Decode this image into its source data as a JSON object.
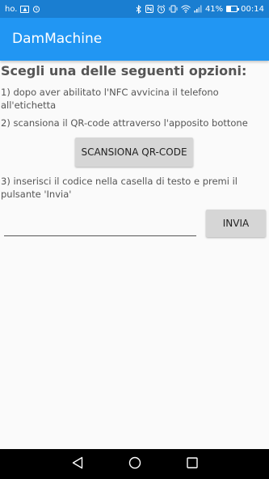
{
  "status_bar": {
    "carrier": "ho.",
    "battery_text": "41%",
    "battery_level": 0.41,
    "time": "00:14",
    "icons": [
      "image-icon",
      "alarm-icon",
      "bluetooth-icon",
      "nfc-icon",
      "vibrate-icon",
      "wifi-icon",
      "signal-icon",
      "battery-icon"
    ]
  },
  "app_bar": {
    "title": "DamMachine",
    "color": "#2196f3"
  },
  "main": {
    "heading": "Scegli una delle seguenti opzioni:",
    "step1": "1) dopo aver abilitato l'NFC avvicina il telefono all'etichetta",
    "step2": "2) scansiona il QR-code attraverso l'apposito bottone",
    "scan_button": "SCANSIONA QR-CODE",
    "step3": "3) inserisci il codice nella casella di testo e premi il pulsante 'Invia'",
    "code_input_value": "",
    "send_button": "INVIA"
  },
  "nav_bar": {
    "icons": [
      "back-icon",
      "home-icon",
      "recents-icon"
    ]
  }
}
